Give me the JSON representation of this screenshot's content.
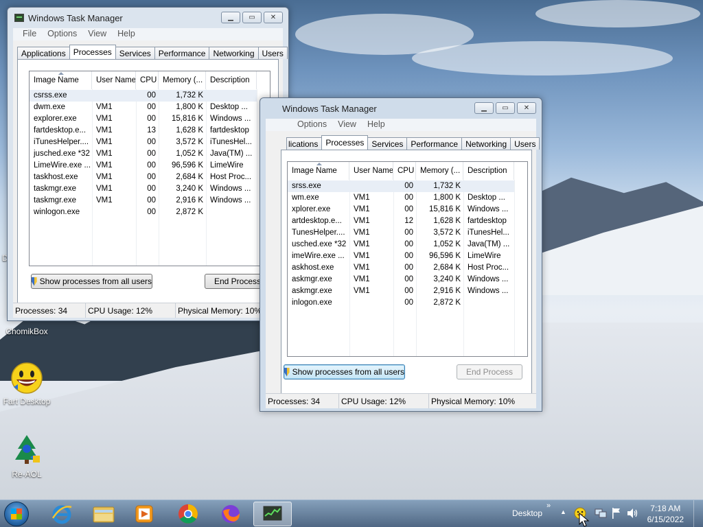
{
  "desktop": {
    "icons": [
      {
        "label": "ChomikBox",
        "icon": "chomikbox-icon"
      },
      {
        "label": "Fart Desktop",
        "icon": "smiley-face-icon"
      },
      {
        "label": "Re-AOL",
        "icon": "aol-tree-icon"
      }
    ],
    "edge_text": "D"
  },
  "task_manager": {
    "title": "Windows Task Manager",
    "menu": [
      "File",
      "Options",
      "View",
      "Help"
    ],
    "tabs": [
      "Applications",
      "Processes",
      "Services",
      "Performance",
      "Networking",
      "Users"
    ],
    "columns": [
      "Image Name",
      "User Name",
      "CPU",
      "Memory (...",
      "Description"
    ],
    "show_all_label": "Show processes from all users",
    "end_process_label": "End Process",
    "status": {
      "processes": "Processes: 34",
      "cpu": "CPU Usage: 12%",
      "memory": "Physical Memory: 10%"
    }
  },
  "back_window": {
    "rows": [
      [
        "csrss.exe",
        "",
        "00",
        "1,732 K",
        ""
      ],
      [
        "dwm.exe",
        "VM1",
        "00",
        "1,800 K",
        "Desktop ..."
      ],
      [
        "explorer.exe",
        "VM1",
        "00",
        "15,816 K",
        "Windows ..."
      ],
      [
        "fartdesktop.e...",
        "VM1",
        "13",
        "1,628 K",
        "fartdesktop"
      ],
      [
        "iTunesHelper....",
        "VM1",
        "00",
        "3,572 K",
        "iTunesHel..."
      ],
      [
        "jusched.exe *32",
        "VM1",
        "00",
        "1,052 K",
        "Java(TM) ..."
      ],
      [
        "LimeWire.exe ...",
        "VM1",
        "00",
        "96,596 K",
        "LimeWire"
      ],
      [
        "taskhost.exe",
        "VM1",
        "00",
        "2,684 K",
        "Host Proc..."
      ],
      [
        "taskmgr.exe",
        "VM1",
        "00",
        "3,240 K",
        "Windows ..."
      ],
      [
        "taskmgr.exe",
        "VM1",
        "00",
        "2,916 K",
        "Windows ..."
      ],
      [
        "winlogon.exe",
        "",
        "00",
        "2,872 K",
        ""
      ]
    ]
  },
  "front_window": {
    "tab_first_visible": "lications",
    "column_first_visible": "Image Name",
    "rows": [
      [
        "srss.exe",
        "",
        "00",
        "1,732 K",
        ""
      ],
      [
        "wm.exe",
        "VM1",
        "00",
        "1,800 K",
        "Desktop ..."
      ],
      [
        "xplorer.exe",
        "VM1",
        "00",
        "15,816 K",
        "Windows ..."
      ],
      [
        "artdesktop.e...",
        "VM1",
        "12",
        "1,628 K",
        "fartdesktop"
      ],
      [
        "TunesHelper....",
        "VM1",
        "00",
        "3,572 K",
        "iTunesHel..."
      ],
      [
        "usched.exe *32",
        "VM1",
        "00",
        "1,052 K",
        "Java(TM) ..."
      ],
      [
        "imeWire.exe ...",
        "VM1",
        "00",
        "96,596 K",
        "LimeWire"
      ],
      [
        "askhost.exe",
        "VM1",
        "00",
        "2,684 K",
        "Host Proc..."
      ],
      [
        "askmgr.exe",
        "VM1",
        "00",
        "3,240 K",
        "Windows ..."
      ],
      [
        "askmgr.exe",
        "VM1",
        "00",
        "2,916 K",
        "Windows ..."
      ],
      [
        "inlogon.exe",
        "",
        "00",
        "2,872 K",
        ""
      ]
    ]
  },
  "taskbar": {
    "apps": [
      "internet-explorer-icon",
      "file-explorer-icon",
      "media-player-icon",
      "chrome-icon",
      "firefox-icon",
      "task-manager-icon"
    ],
    "desktop_label": "Desktop",
    "time": "7:18 AM",
    "date": "6/15/2022"
  }
}
